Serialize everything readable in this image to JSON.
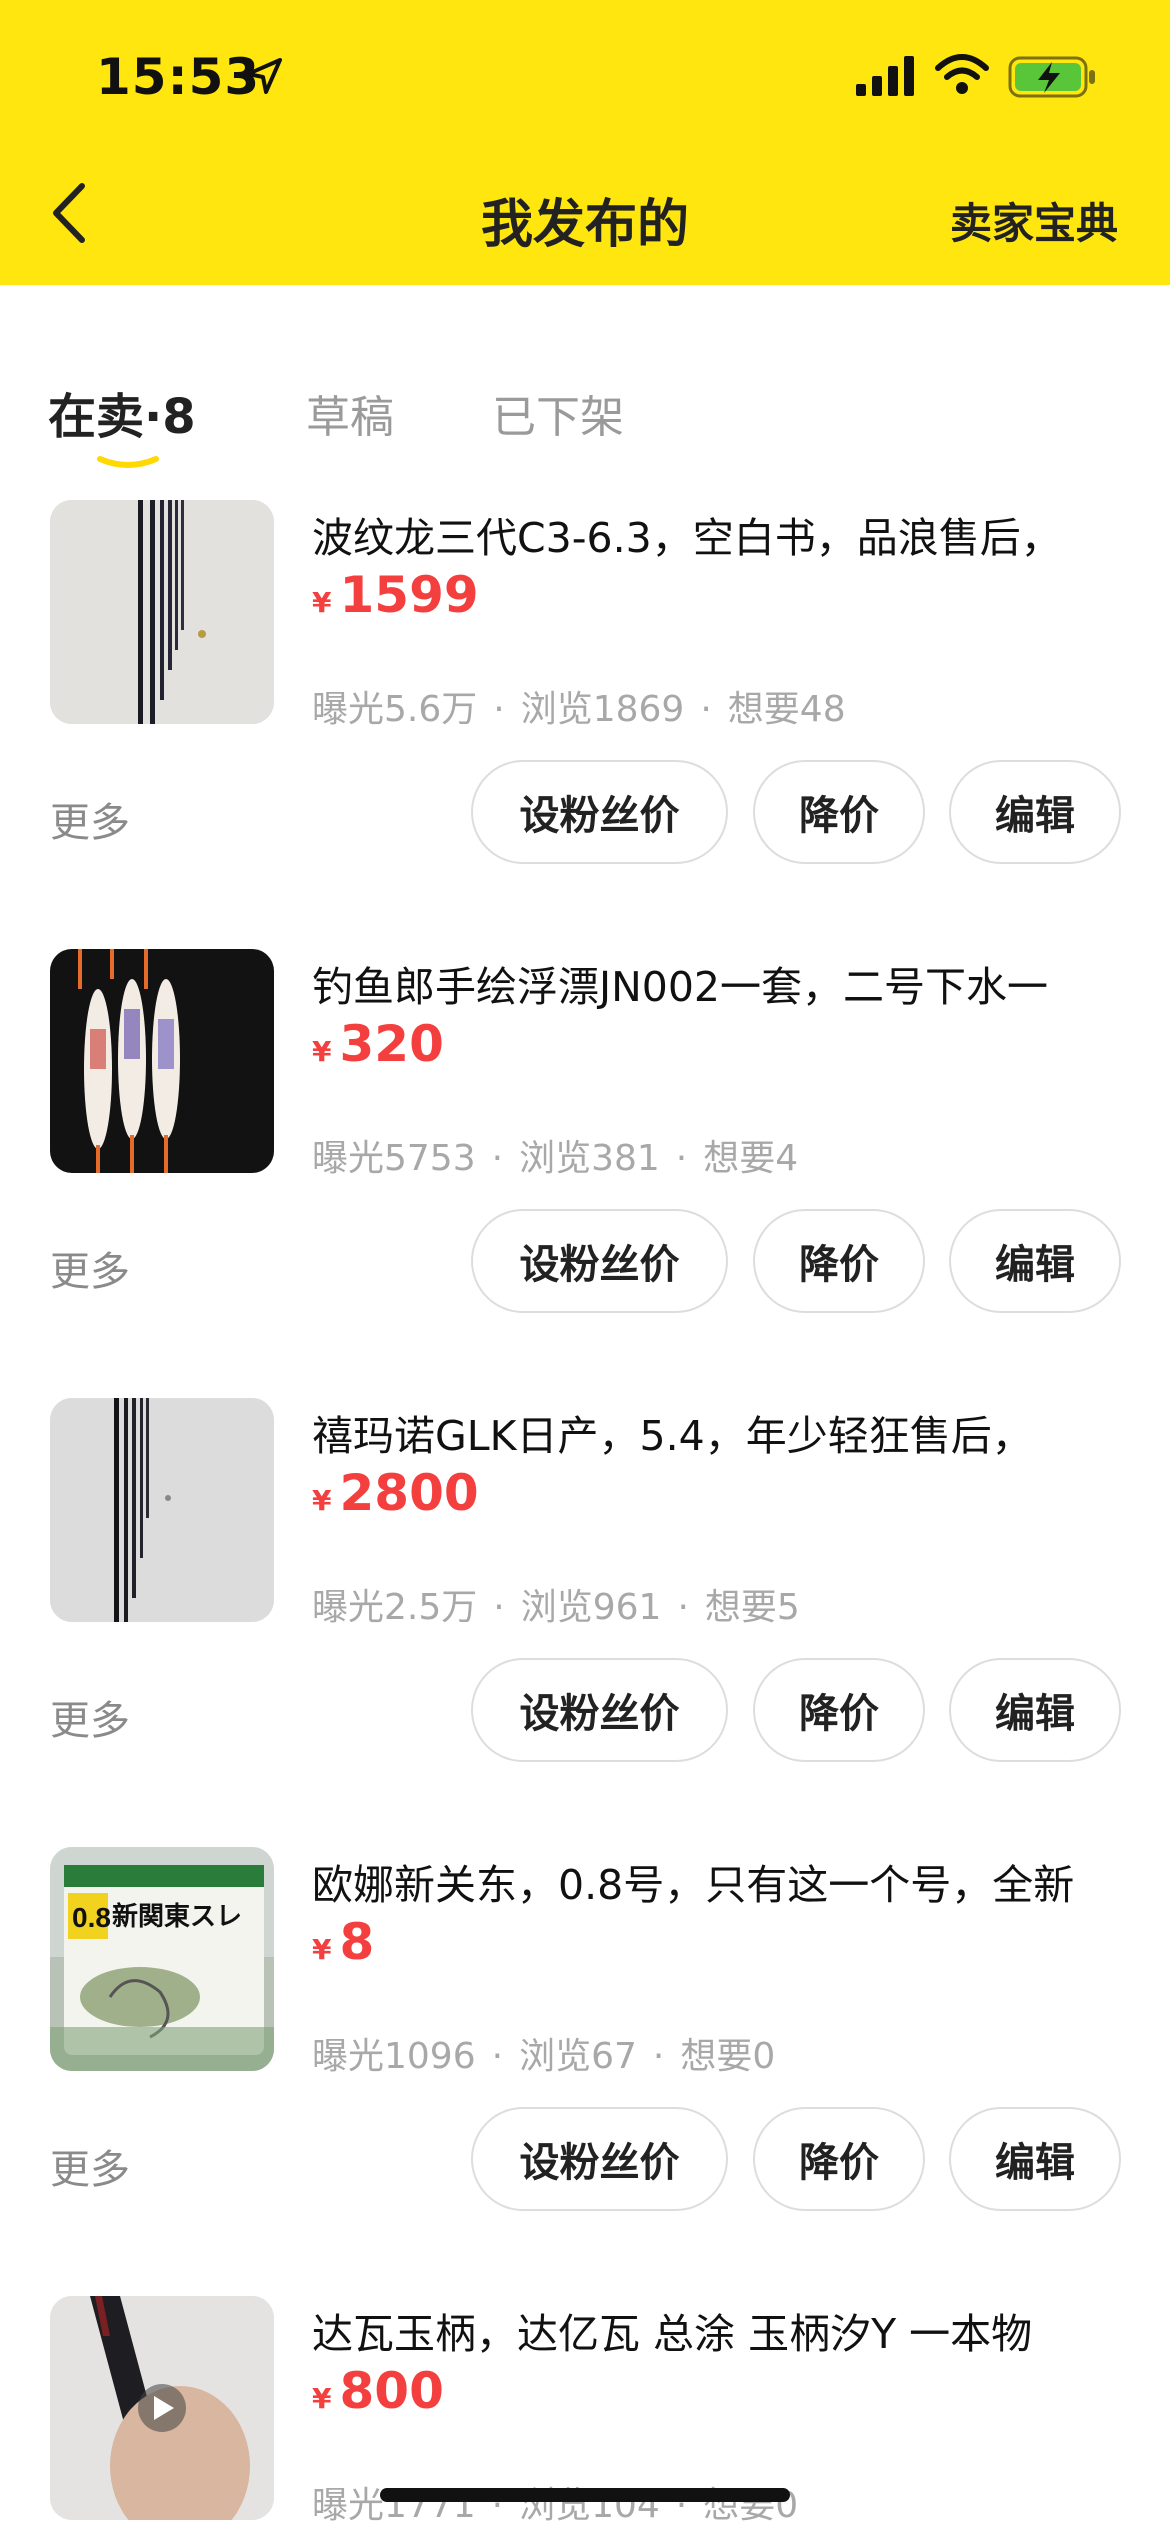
{
  "status_bar": {
    "time": "15:53"
  },
  "nav": {
    "title": "我发布的",
    "right_link": "卖家宝典"
  },
  "tabs": [
    {
      "label": "在卖",
      "count": "8"
    },
    {
      "label": "草稿"
    },
    {
      "label": "已下架"
    }
  ],
  "items": [
    {
      "title": "波纹龙三代C3-6.3，空白书，品浪售后，",
      "currency": "¥",
      "price": "1599",
      "exposure": "曝光5.6万",
      "views": "浏览1869",
      "wants": "想要48",
      "more": "更多",
      "btn_fans": "设粉丝价",
      "btn_down": "降价",
      "btn_edit": "编辑"
    },
    {
      "title": "钓鱼郎手绘浮漂JN002一套，二号下水一",
      "currency": "¥",
      "price": "320",
      "exposure": "曝光5753",
      "views": "浏览381",
      "wants": "想要4",
      "more": "更多",
      "btn_fans": "设粉丝价",
      "btn_down": "降价",
      "btn_edit": "编辑"
    },
    {
      "title": "禧玛诺GLK日产，5.4，年少轻狂售后，",
      "currency": "¥",
      "price": "2800",
      "exposure": "曝光2.5万",
      "views": "浏览961",
      "wants": "想要5",
      "more": "更多",
      "btn_fans": "设粉丝价",
      "btn_down": "降价",
      "btn_edit": "编辑"
    },
    {
      "title": "欧娜新关东，0.8号，只有这一个号，全新",
      "currency": "¥",
      "price": "8",
      "exposure": "曝光1096",
      "views": "浏览67",
      "wants": "想要0",
      "more": "更多",
      "btn_fans": "设粉丝价",
      "btn_down": "降价",
      "btn_edit": "编辑"
    },
    {
      "title": "达瓦玉柄，达亿瓦 总涂 玉柄汐Y 一本物",
      "currency": "¥",
      "price": "800",
      "exposure": "曝光1771",
      "views": "浏览104",
      "wants": "想要0"
    }
  ],
  "thumb_text": {
    "pack_number": "0.8",
    "pack_brand": "新関東スレ"
  },
  "colors": {
    "header_yellow": "#FFE60F",
    "price_red": "#F43F3F"
  }
}
